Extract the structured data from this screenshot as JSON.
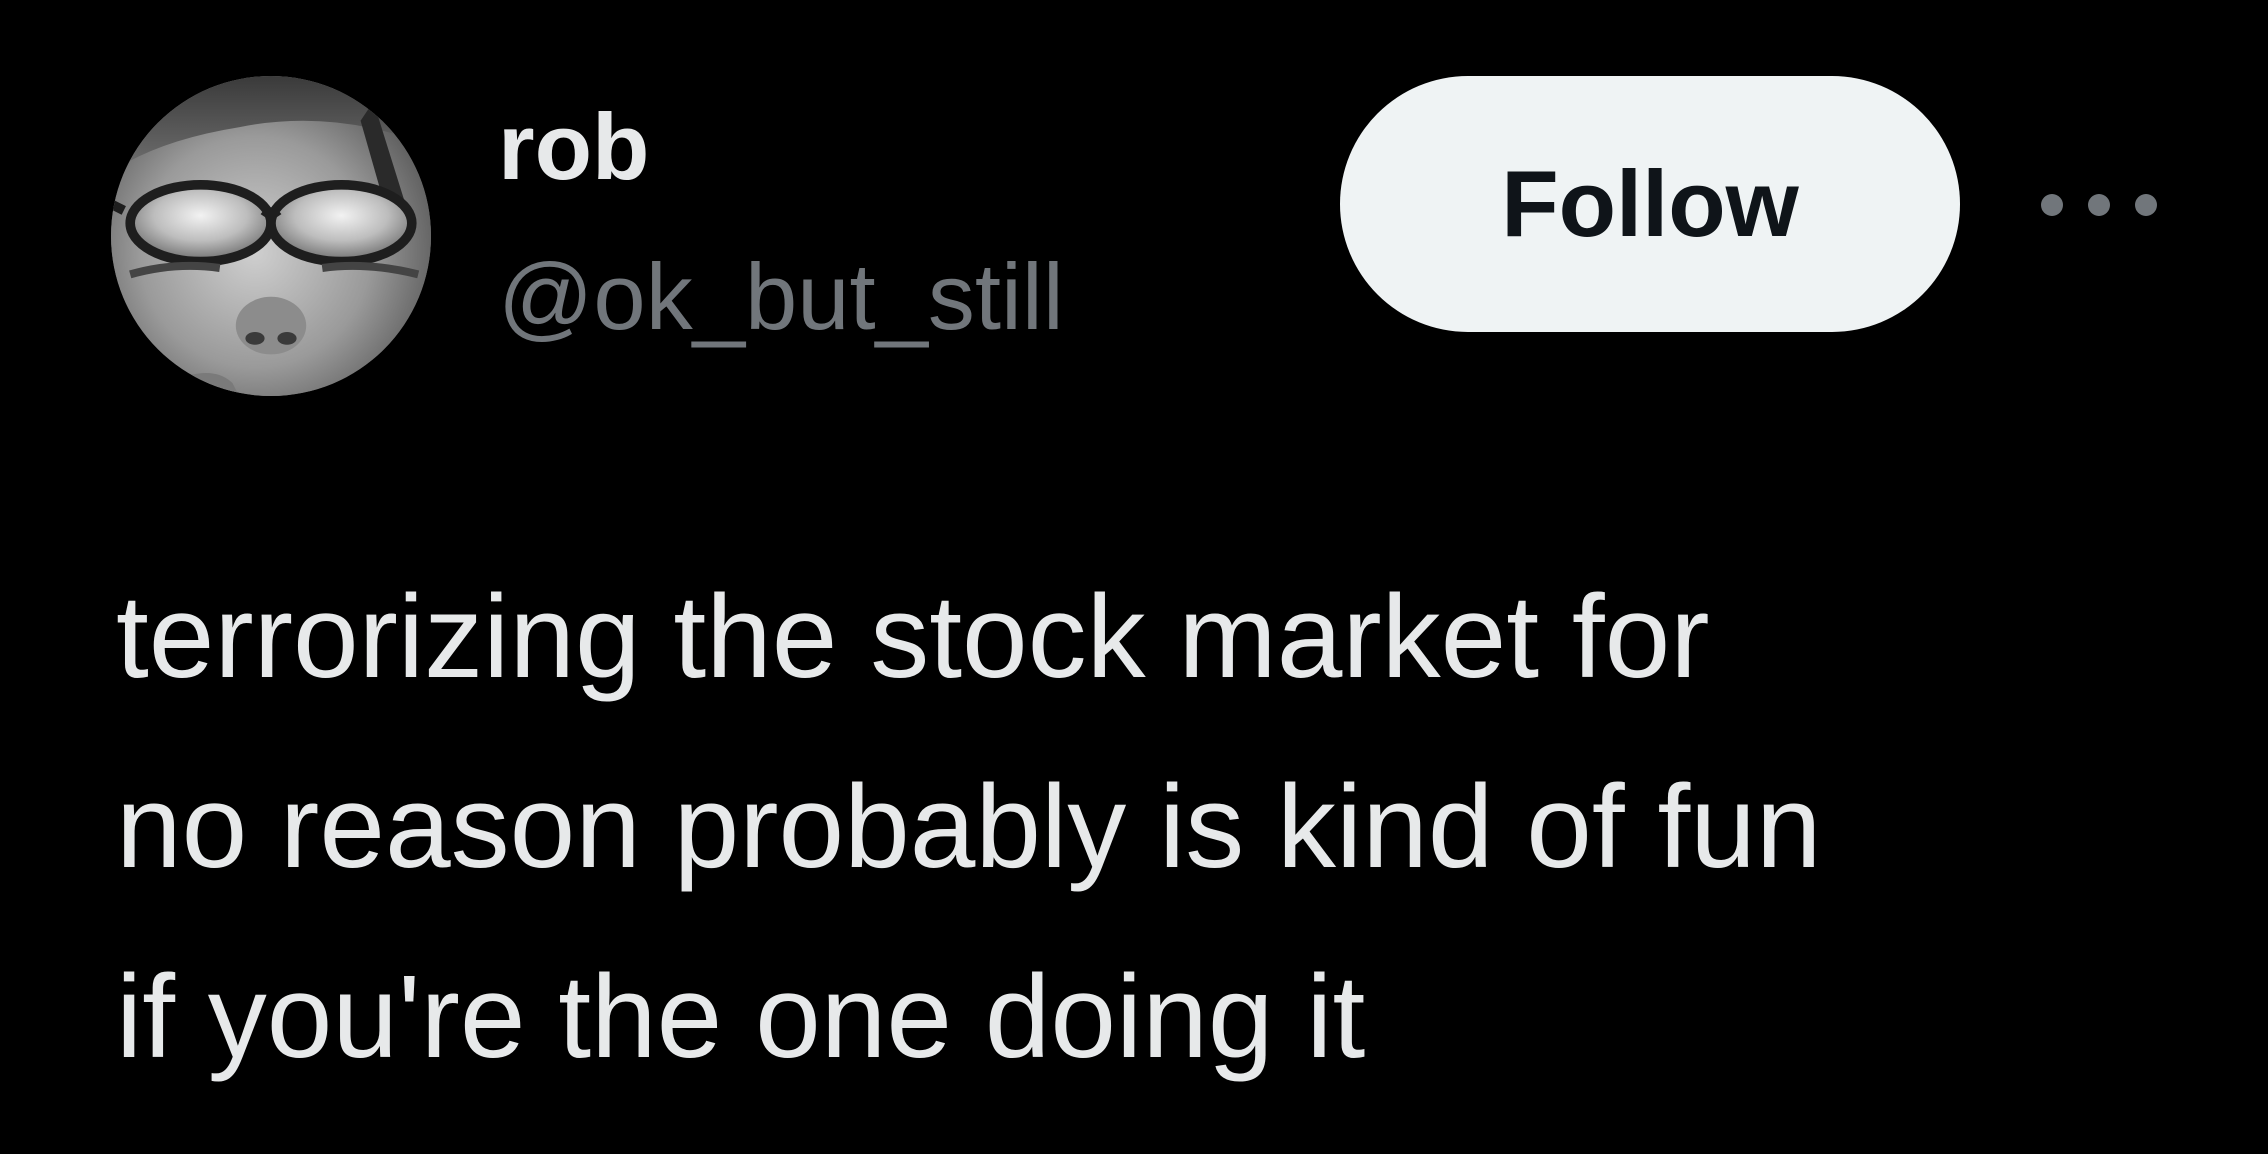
{
  "author": {
    "display_name": "rob",
    "handle": "@ok_but_still",
    "avatar_icon": "profile-photo"
  },
  "actions": {
    "follow_label": "Follow",
    "more_icon": "ellipsis-icon"
  },
  "tweet": {
    "lines": [
      "terrorizing the stock market for",
      "no reason probably is kind of fun",
      "if you're the one doing it"
    ]
  },
  "colors": {
    "background": "#000000",
    "primary_text": "#e7e9ea",
    "secondary_text": "#71767b",
    "follow_button_bg": "#eff3f4",
    "follow_button_text": "#0f1419"
  }
}
